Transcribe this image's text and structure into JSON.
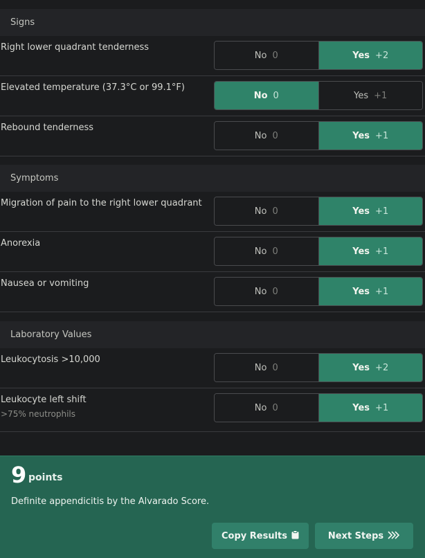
{
  "sections": {
    "signs": "Signs",
    "symptoms": "Symptoms",
    "lab": "Laboratory Values"
  },
  "rows": {
    "rlq": {
      "label": "Right lower quadrant tenderness",
      "no": "No",
      "no_pts": "0",
      "yes": "Yes",
      "yes_pts": "+2",
      "selected": "yes"
    },
    "temp": {
      "label": "Elevated temperature (37.3°C or 99.1°F)",
      "no": "No",
      "no_pts": "0",
      "yes": "Yes",
      "yes_pts": "+1",
      "selected": "no"
    },
    "rebound": {
      "label": "Rebound tenderness",
      "no": "No",
      "no_pts": "0",
      "yes": "Yes",
      "yes_pts": "+1",
      "selected": "yes"
    },
    "migration": {
      "label": "Migration of pain to the right lower quadrant",
      "no": "No",
      "no_pts": "0",
      "yes": "Yes",
      "yes_pts": "+1",
      "selected": "yes"
    },
    "anorexia": {
      "label": "Anorexia",
      "no": "No",
      "no_pts": "0",
      "yes": "Yes",
      "yes_pts": "+1",
      "selected": "yes"
    },
    "nausea": {
      "label": "Nausea or vomiting",
      "no": "No",
      "no_pts": "0",
      "yes": "Yes",
      "yes_pts": "+1",
      "selected": "yes"
    },
    "leukocytosis": {
      "label": "Leukocytosis >10,000",
      "no": "No",
      "no_pts": "0",
      "yes": "Yes",
      "yes_pts": "+2",
      "selected": "yes"
    },
    "leftshift": {
      "label": "Leukocyte left shift",
      "sublabel": ">75% neutrophils",
      "no": "No",
      "no_pts": "0",
      "yes": "Yes",
      "yes_pts": "+1",
      "selected": "yes"
    }
  },
  "result": {
    "score": "9",
    "unit": "points",
    "interpretation": "Definite appendicitis by the Alvarado Score.",
    "copy_label": "Copy Results",
    "copy_icon": "clipboard-icon",
    "next_label": "Next Steps",
    "next_icon": "chevrons-right-icon"
  },
  "colors": {
    "selected": "#2f8369",
    "result_bg": "#256552",
    "button": "#31806a"
  }
}
